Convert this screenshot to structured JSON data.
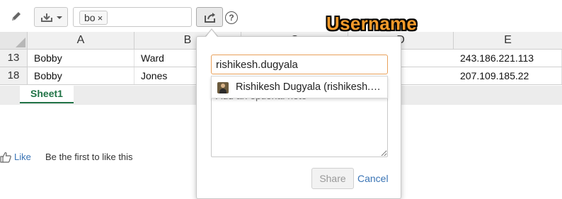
{
  "toolbar": {
    "filter_chip": "bo",
    "filter_chip_remove": "×",
    "help_label": "?"
  },
  "annotation": {
    "label": "Username"
  },
  "grid": {
    "columns": [
      "A",
      "B",
      "C",
      "D",
      "E"
    ],
    "rows": [
      {
        "row": "13",
        "a": "Bobby",
        "b": "Ward",
        "e": "243.186.221.113"
      },
      {
        "row": "18",
        "a": "Bobby",
        "b": "Jones",
        "e": "207.109.185.22"
      }
    ]
  },
  "sheets": {
    "active": "Sheet1"
  },
  "like": {
    "link": "Like",
    "text": "Be the first to like this"
  },
  "share_popup": {
    "username_value": "rishikesh.dugyala",
    "note_placeholder": "Add an optional note",
    "suggestion": "Rishikesh Dugyala (rishikesh.dugyala)",
    "share_button": "Share",
    "cancel_link": "Cancel"
  },
  "colors": {
    "accent_orange": "#f39a2a",
    "sheet_green": "#217346",
    "link_blue": "#3a74b5"
  }
}
